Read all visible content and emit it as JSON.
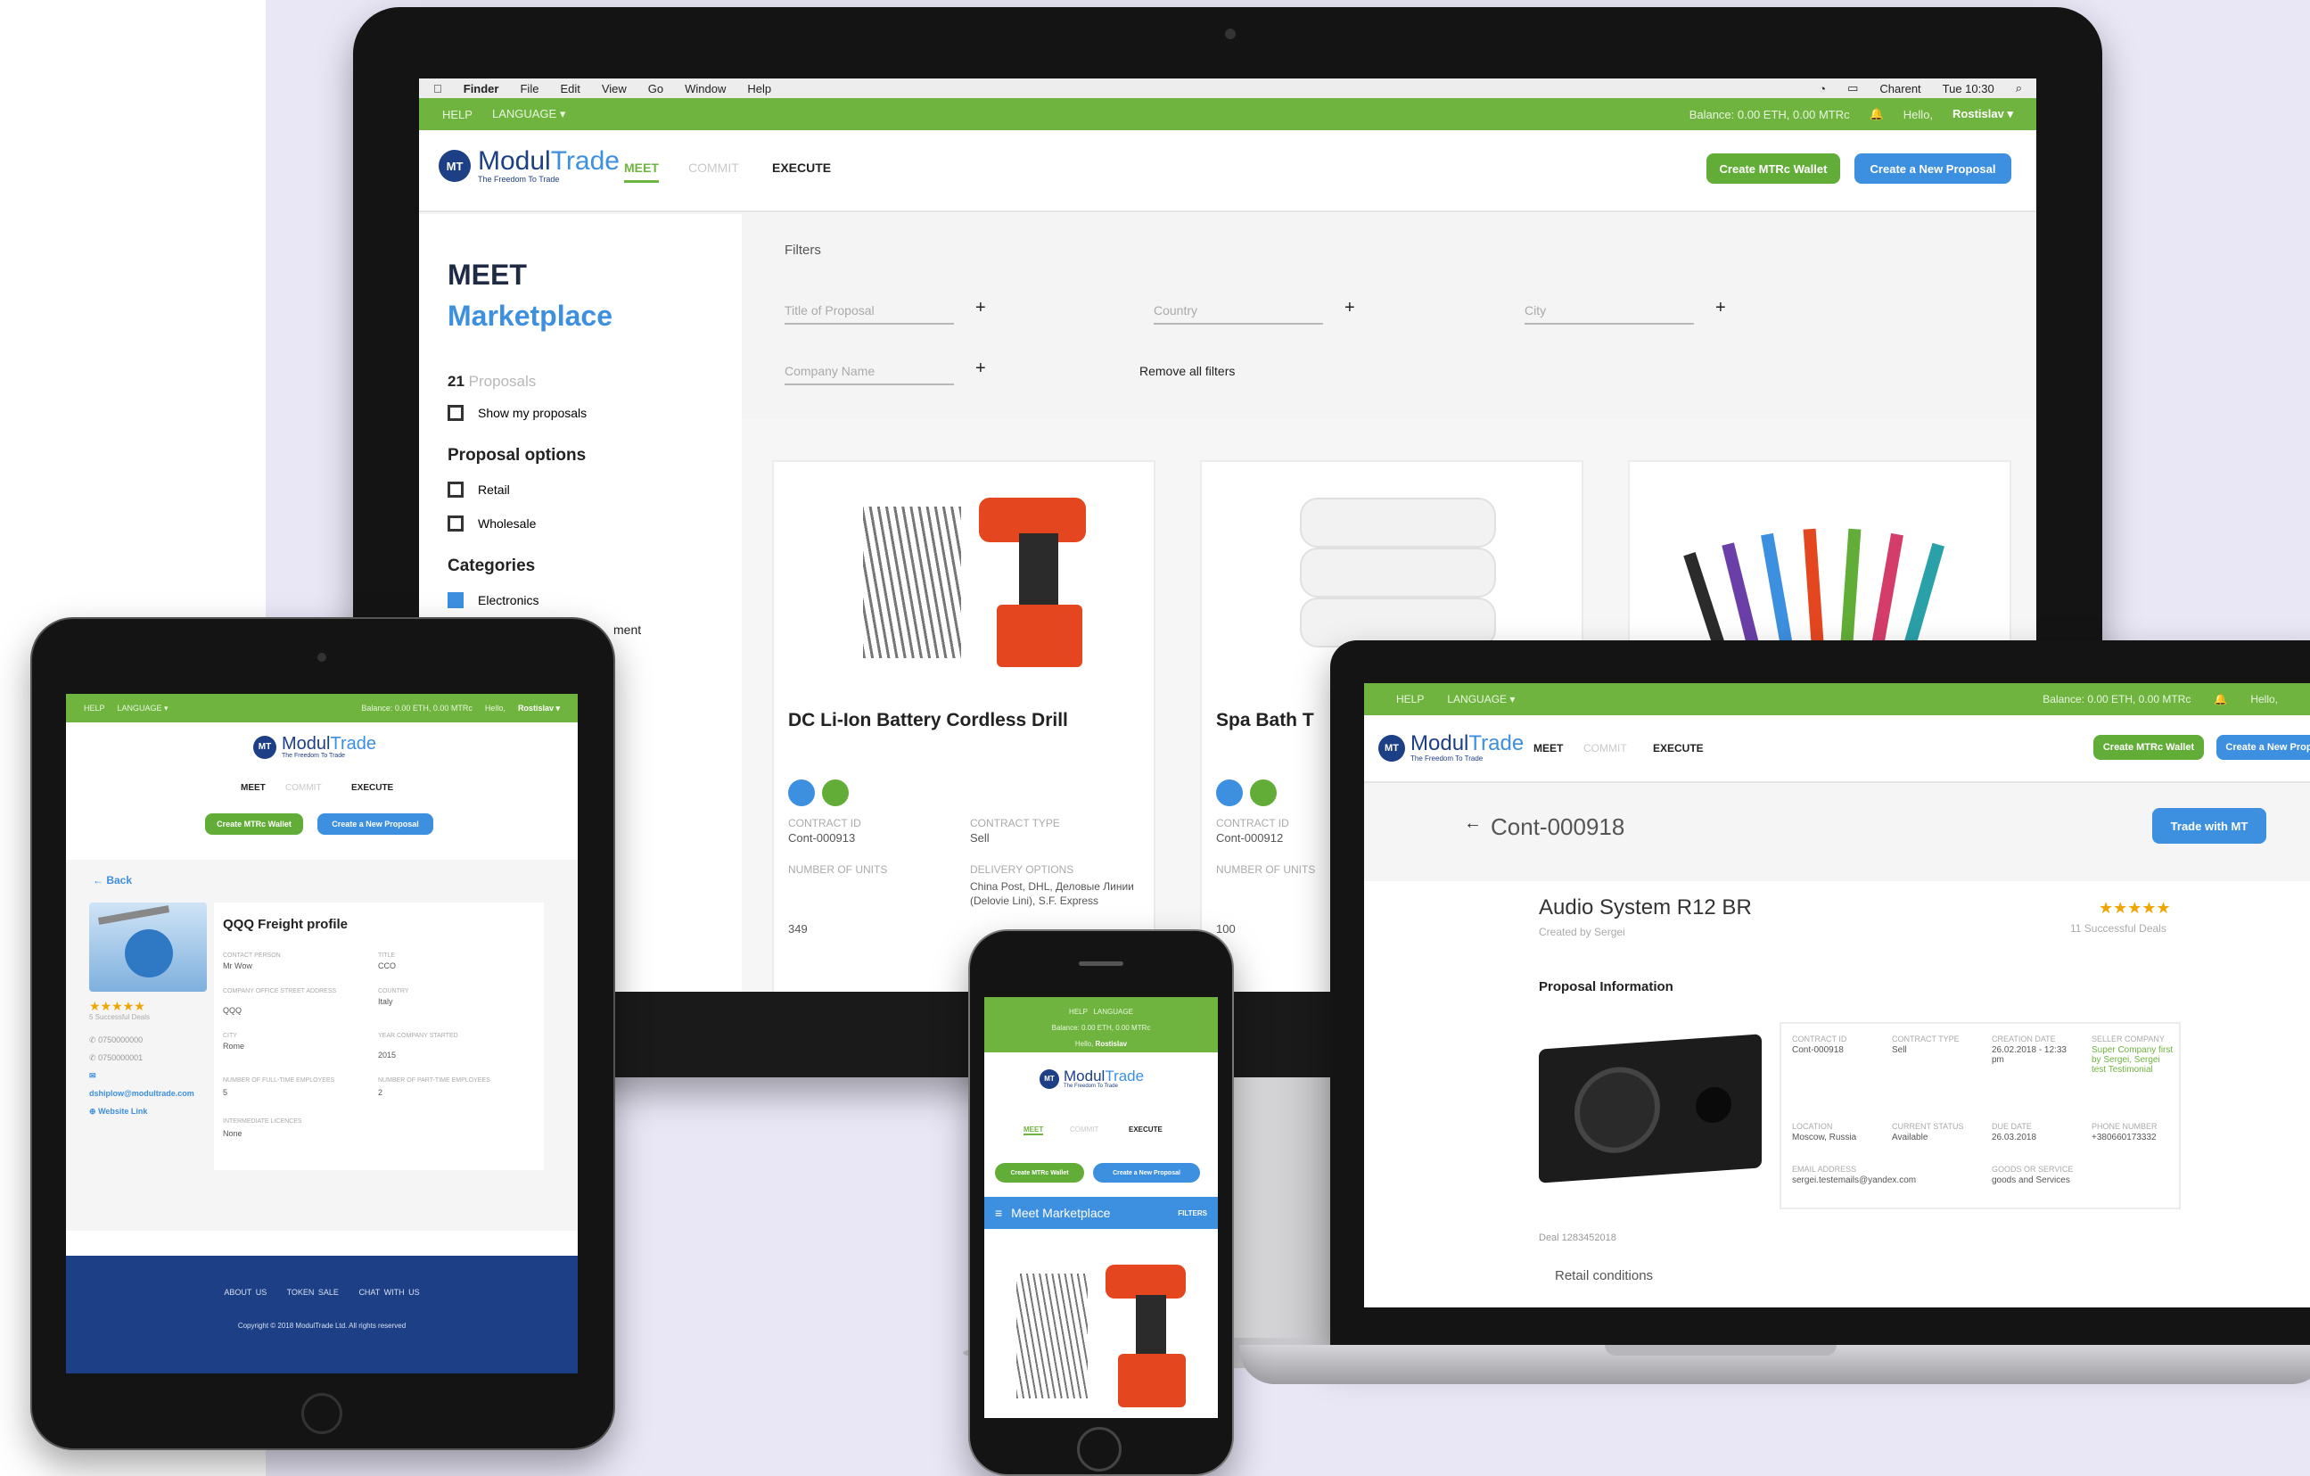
{
  "mac_menu": {
    "apple": "",
    "items": [
      "Finder",
      "File",
      "Edit",
      "View",
      "Go",
      "Window",
      "Help"
    ],
    "status_user": "Charent",
    "status_time": "Tue 10:30"
  },
  "topbar": {
    "help": "HELP",
    "language": "LANGUAGE",
    "balance": "Balance: 0.00 ETH, 0.00 MTRc",
    "hello": "Hello,",
    "user": "Rostislav"
  },
  "brand": {
    "logo_mark": "MT",
    "name_part1": "Modul",
    "name_part2": "Trade",
    "tagline": "The Freedom To Trade"
  },
  "nav": {
    "meet": "MEET",
    "commit": "COMMIT",
    "execute": "EXECUTE"
  },
  "buttons": {
    "create_wallet": "Create MTRc Wallet",
    "create_proposal": "Create a New Proposal",
    "trade_with_mt": "Trade with MT"
  },
  "sidebar": {
    "title_line1": "MEET",
    "title_line2": "Marketplace",
    "proposals_count": "21",
    "proposals_label": "Proposals",
    "show_my": "Show my proposals",
    "options_heading": "Proposal options",
    "retail": "Retail",
    "wholesale": "Wholesale",
    "categories_heading": "Categories",
    "electronics": "Electronics",
    "cut_text": "ment"
  },
  "filters": {
    "heading": "Filters",
    "title_placeholder": "Title of Proposal",
    "country_placeholder": "Country",
    "city_placeholder": "City",
    "company_placeholder": "Company Name",
    "remove_all": "Remove all filters",
    "plus": "+"
  },
  "cards": [
    {
      "title": "DC Li-Ion Battery Cordless Drill",
      "contract_id_label": "Contract ID",
      "contract_id": "Cont-000913",
      "contract_type_label": "Contract Type",
      "contract_type": "Sell",
      "units_label": "Number of Units",
      "units": "349",
      "delivery_label": "Delivery Options",
      "delivery": "China Post, DHL, Деловые Линии (Delovie Lini), S.F. Express"
    },
    {
      "title": "Spa Bath T",
      "contract_id_label": "Contract ID",
      "contract_id": "Cont-000912",
      "units_label": "Number of Units",
      "units": "100"
    },
    {
      "title": ""
    }
  ],
  "tablet": {
    "back": "Back",
    "profile_title": "QQQ Freight profile",
    "contact_person_label": "Contact Person",
    "contact_person": "Mr Wow",
    "title_label": "Title",
    "title": "CCO",
    "address_label": "Company Office Street Address",
    "address": "QQQ",
    "country_label": "Country",
    "country": "Italy",
    "city_label": "City",
    "city": "Rome",
    "year_label": "Year Company Started",
    "year": "2015",
    "fulltime_label": "Number of Full-time Employees",
    "fulltime": "5",
    "parttime_label": "Number of Part-time Employees",
    "parttime": "2",
    "licences_label": "Intermediate Licences",
    "licences": "None",
    "stars": "★★★★★",
    "deals": "5 Successful Deals",
    "phone1": "0750000000",
    "phone2": "0750000001",
    "email": "dshiplow@modultrade.com",
    "website": "Website Link",
    "footer_about": "ABOUT US",
    "footer_token": "TOKEN SALE",
    "footer_chat": "CHAT WITH US",
    "copyright": "Copyright © 2018 ModulTrade Ltd. All rights reserved"
  },
  "laptop": {
    "contract": "Cont-000918",
    "product": "Audio System R12 BR",
    "created_by": "Created by Sergei",
    "stars": "★★★★★",
    "deals": "11 Successful Deals",
    "proposal_info": "Proposal Information",
    "contract_id_label": "Contract ID",
    "contract_id": "Cont-000918",
    "contract_type_label": "Contract Type",
    "contract_type": "Sell",
    "creation_label": "Creation Date",
    "creation": "26.02.2018 - 12:33 pm",
    "seller_label": "Seller Company",
    "seller": "Super Company first by Sergei, Sergei test Testimonial",
    "location_label": "Location",
    "location": "Moscow, Russia",
    "status_label": "Current Status",
    "status": "Available",
    "due_label": "Due Date",
    "due": "26.03.2018",
    "phone_label": "Phone Number",
    "phone": "+380660173332",
    "email_label": "Email Address",
    "email": "sergei.testemails@yandex.com",
    "goods_label": "Goods or Service",
    "goods": "goods and Services",
    "doc": "Deal 1283452018",
    "retail": "Retail conditions"
  },
  "phone": {
    "menu": "Meet Marketplace",
    "filters": "FILTERS"
  },
  "colors": {
    "green": "#6fb43f",
    "blue": "#3d8fe0",
    "navy": "#1d3f86",
    "lavender": "#e9e7f6"
  }
}
